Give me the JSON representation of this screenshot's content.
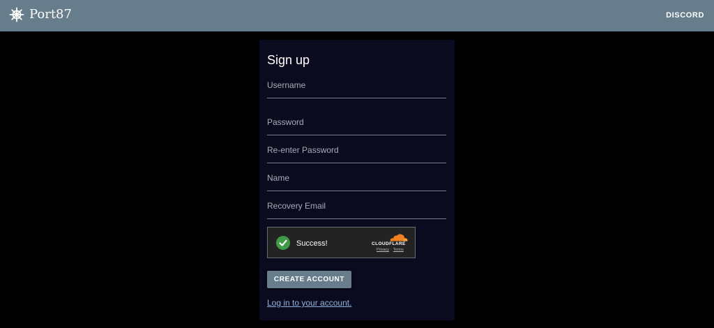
{
  "app": {
    "name": "Port87",
    "logo_icon": "ship-wheel-icon"
  },
  "nav": {
    "discord_label": "DISCORD"
  },
  "form": {
    "title": "Sign up",
    "fields": [
      {
        "label": "Username"
      },
      {
        "label": "Password"
      },
      {
        "label": "Re-enter Password"
      },
      {
        "label": "Name"
      },
      {
        "label": "Recovery Email"
      }
    ],
    "captcha": {
      "status_text": "Success!",
      "brand": "CLOUDFLARE",
      "privacy_label": "Privacy",
      "separator": "·",
      "terms_label": "Terms",
      "status_icon": "check-circle-icon",
      "status_color": "#3d9b45",
      "brand_color": "#f38020"
    },
    "submit_label": "CREATE ACCOUNT",
    "login_link": "Log in to your account."
  },
  "colors": {
    "appbar": "#677d8b",
    "card": "#0a0b1f",
    "link": "#90b4de"
  }
}
